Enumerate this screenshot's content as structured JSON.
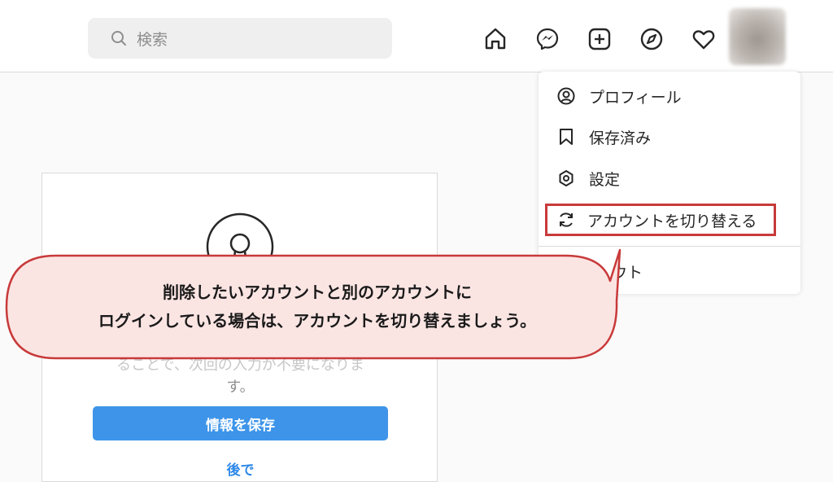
{
  "header": {
    "search": {
      "placeholder": "検索",
      "icon": "search-icon"
    },
    "nav_icons": [
      "home-icon",
      "messenger-icon",
      "new-post-icon",
      "explore-icon",
      "activity-heart-icon"
    ],
    "avatar": "profile-avatar"
  },
  "menu": {
    "items": [
      {
        "label": "プロフィール",
        "icon": "profile-circle-icon"
      },
      {
        "label": "保存済み",
        "icon": "bookmark-icon"
      },
      {
        "label": "設定",
        "icon": "settings-icon"
      },
      {
        "label": "アカウントを切り替える",
        "icon": "switch-account-icon",
        "highlighted": true
      }
    ],
    "logout_partial": "ウト"
  },
  "card": {
    "text_line1": "ることで、次回の入力が不要になりま",
    "text_line2": "す。",
    "save_button": "情報を保存",
    "later_link": "後で"
  },
  "callout": {
    "line1": "削除したいアカウントと別のアカウントに",
    "line2": "ログインしている場合は、アカウントを切り替えましょう。",
    "border_color": "#c83a3a",
    "fill_color": "#fbe5e3"
  },
  "colors": {
    "highlight": "#c83a3a",
    "primary_button": "#3d94e9",
    "link": "#2f89e8"
  }
}
